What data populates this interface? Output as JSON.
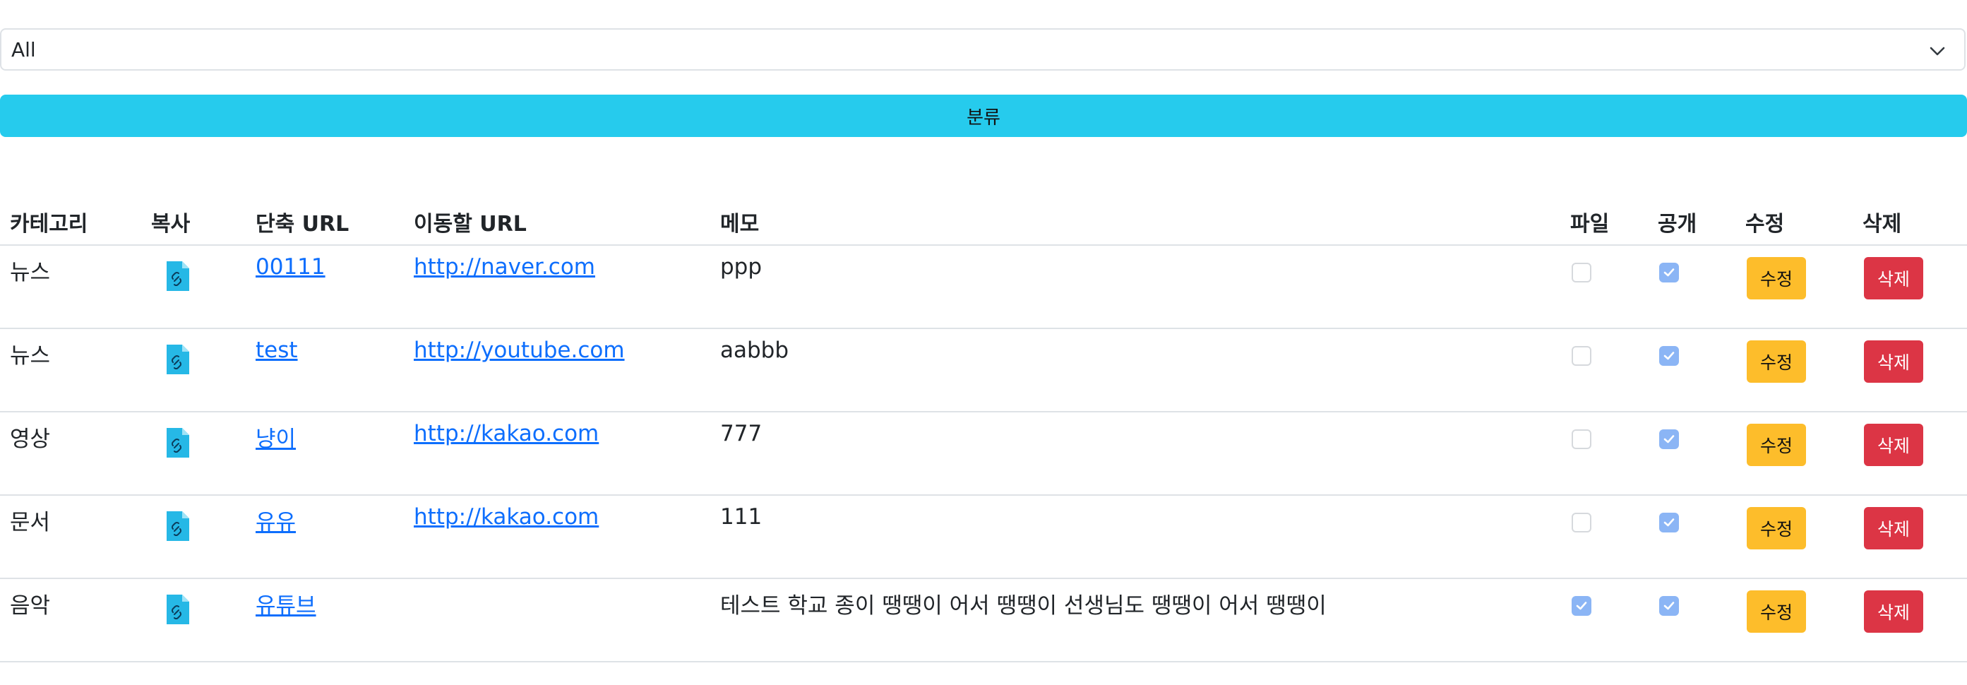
{
  "filter": {
    "selected": "All",
    "submit_label": "분류"
  },
  "table": {
    "headers": {
      "category": "카테고리",
      "copy": "복사",
      "short_url": "단축 URL",
      "target_url": "이동할 URL",
      "memo": "메모",
      "file": "파일",
      "public": "공개",
      "edit": "수정",
      "delete": "삭제"
    },
    "rows": [
      {
        "category": "뉴스",
        "short_url": "00111",
        "target_url": "http://naver.com",
        "memo": "ppp",
        "file": false,
        "public": true,
        "edit_label": "수정",
        "delete_label": "삭제"
      },
      {
        "category": "뉴스",
        "short_url": "test",
        "target_url": "http://youtube.com",
        "memo": "aabbb",
        "file": false,
        "public": true,
        "edit_label": "수정",
        "delete_label": "삭제"
      },
      {
        "category": "영상",
        "short_url": "냥이",
        "target_url": "http://kakao.com",
        "memo": "777",
        "file": false,
        "public": true,
        "edit_label": "수정",
        "delete_label": "삭제"
      },
      {
        "category": "문서",
        "short_url": "유유",
        "target_url": "http://kakao.com",
        "memo": "111",
        "file": false,
        "public": true,
        "edit_label": "수정",
        "delete_label": "삭제"
      },
      {
        "category": "음악",
        "short_url": "유튜브",
        "target_url": "",
        "memo": "테스트 학교 종이 땡땡이 어서 땡땡이 선생님도 땡땡이 어서 땡땡이",
        "file": true,
        "public": true,
        "edit_label": "수정",
        "delete_label": "삭제"
      }
    ]
  },
  "icons": {
    "copy": "file-link-icon",
    "select_arrow": "chevron-down-icon"
  },
  "colors": {
    "primary_link": "#0d6efd",
    "filter_button": "#26cbed",
    "edit_button": "#fdbd2b",
    "delete_button": "#dc3545",
    "checkbox_checked": "#8bb5f5"
  }
}
